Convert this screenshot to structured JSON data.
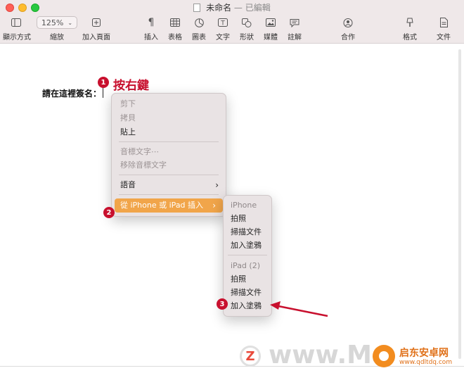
{
  "window": {
    "title": "未命名",
    "separator": "—",
    "status": "已編輯"
  },
  "toolbar": {
    "view": "顯示方式",
    "zoom_value": "125%",
    "zoom": "縮放",
    "add_page": "加入頁面",
    "insert": "插入",
    "table": "表格",
    "chart": "圖表",
    "text": "文字",
    "shape": "形狀",
    "media": "媒體",
    "comment": "註解",
    "collaborate": "合作",
    "format": "格式",
    "document": "文件"
  },
  "document": {
    "text": "請在這裡簽名："
  },
  "annotations": {
    "step1": "1",
    "step1_label": "按右鍵",
    "step2": "2",
    "step3": "3",
    "color": "#c8102e"
  },
  "context_menu": {
    "cut": "剪下",
    "copy": "拷貝",
    "paste": "貼上",
    "phonetic": "音標文字⋯",
    "remove_phonetic": "移除音標文字",
    "speech": "語音",
    "insert_from_device": "從 iPhone 或 iPad 插入",
    "highlight_color": "#f1a54a"
  },
  "submenu": {
    "iphone_header": "iPhone",
    "iphone_photo": "拍照",
    "iphone_scan": "掃描文件",
    "iphone_sketch": "加入塗鴉",
    "ipad_header": "iPad (2)",
    "ipad_photo": "拍照",
    "ipad_scan": "掃描文件",
    "ipad_sketch": "加入塗鴉"
  },
  "watermark": {
    "z": "Z",
    "text": "www.Ma",
    "site": "启东安卓网",
    "url": "www.qdltdq.com"
  },
  "icons": [
    "view-icon",
    "zoom-dropdown-icon",
    "add-page-icon",
    "insert-icon",
    "table-icon",
    "chart-icon",
    "text-icon",
    "shape-icon",
    "media-icon",
    "comment-icon",
    "collaborate-icon",
    "format-icon",
    "document-icon",
    "chevron-right-icon",
    "arrow-annotation"
  ]
}
